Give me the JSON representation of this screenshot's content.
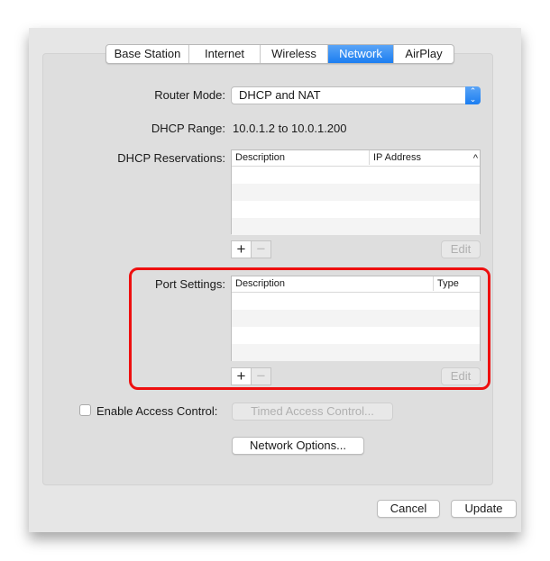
{
  "tabs": [
    {
      "label": "Base Station"
    },
    {
      "label": "Internet"
    },
    {
      "label": "Wireless"
    },
    {
      "label": "Network",
      "active": true
    },
    {
      "label": "AirPlay"
    }
  ],
  "router_mode": {
    "label": "Router Mode:",
    "value": "DHCP and NAT",
    "icon": "up-down-chevron-icon"
  },
  "dhcp_range": {
    "label": "DHCP Range:",
    "value": "10.0.1.2 to 10.0.1.200"
  },
  "dhcp_reservations": {
    "label": "DHCP Reservations:",
    "columns": [
      "Description",
      "IP Address"
    ],
    "sort_indicator": "^",
    "add": "+",
    "remove": "−",
    "edit": "Edit"
  },
  "port_settings": {
    "label": "Port Settings:",
    "columns": [
      "Description",
      "Type"
    ],
    "add": "+",
    "remove": "−",
    "edit": "Edit",
    "highlight_color": "#ee0f0f"
  },
  "access_control": {
    "label": "Enable Access Control:",
    "checked": false,
    "timed_button": "Timed Access Control..."
  },
  "network_options": "Network Options...",
  "footer": {
    "cancel": "Cancel",
    "update": "Update"
  },
  "colors": {
    "accent": "#1b7ef1"
  }
}
